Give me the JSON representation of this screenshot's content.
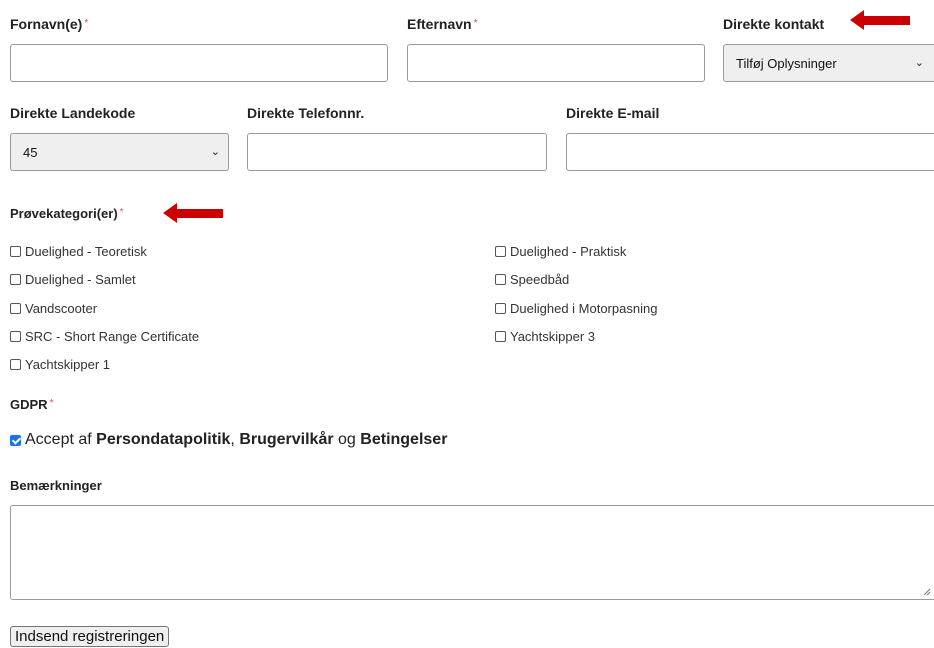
{
  "form": {
    "first_name_label": "Fornavn(e)",
    "last_name_label": "Efternavn",
    "direct_contact_label": "Direkte kontakt",
    "direct_contact_select_value": "Tilføj Oplysninger",
    "country_code_label": "Direkte Landekode",
    "country_code_value": "45",
    "phone_label": "Direkte Telefonnr.",
    "email_label": "Direkte E-mail",
    "categories_label": "Prøvekategori(er)",
    "required_mark": "*",
    "categories_left": [
      "Duelighed - Teoretisk",
      "Duelighed - Samlet",
      "Vandscooter",
      "SRC - Short Range Certificate",
      "Yachtskipper 1"
    ],
    "categories_right": [
      "Duelighed - Praktisk",
      "Speedbåd",
      "Duelighed i Motorpasning",
      "Yachtskipper 3"
    ],
    "gdpr_label": "GDPR",
    "gdpr_accept_prefix": "Accept af",
    "gdpr_link_privacy": "Persondatapolitik",
    "gdpr_comma": ",",
    "gdpr_link_terms": "Brugervilkår",
    "gdpr_og": "og",
    "gdpr_link_conditions": "Betingelser",
    "gdpr_checked": true,
    "remarks_label": "Bemærkninger",
    "submit_label": "Indsend registreringen"
  },
  "colors": {
    "required": "#d9534f",
    "arrow": "#cc0000",
    "checkbox_checked": "#1a73e8"
  }
}
